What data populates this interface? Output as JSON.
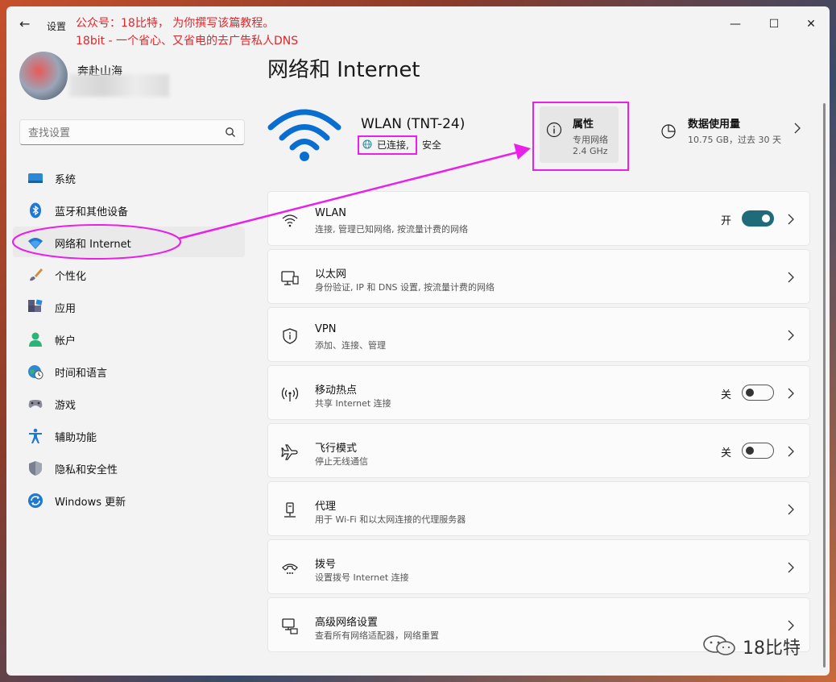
{
  "titlebar": {
    "back_glyph": "←",
    "title": "设置",
    "annotation_line1": "公众号：18比特， 为你撰写该篇教程。",
    "annotation_line2": "18bit - 一个省心、又省电的去广告私人DNS",
    "minimize_glyph": "—",
    "maximize_glyph": "☐",
    "close_glyph": "✕"
  },
  "user": {
    "name": "奔赴山海"
  },
  "search": {
    "placeholder": "查找设置"
  },
  "sidebar": {
    "items": [
      {
        "label": "系统",
        "icon": "display-icon",
        "active": false
      },
      {
        "label": "蓝牙和其他设备",
        "icon": "bluetooth-icon",
        "active": false
      },
      {
        "label": "网络和 Internet",
        "icon": "wifi-icon",
        "active": true
      },
      {
        "label": "个性化",
        "icon": "brush-icon",
        "active": false
      },
      {
        "label": "应用",
        "icon": "apps-icon",
        "active": false
      },
      {
        "label": "帐户",
        "icon": "person-icon",
        "active": false
      },
      {
        "label": "时间和语言",
        "icon": "globe-clock-icon",
        "active": false
      },
      {
        "label": "游戏",
        "icon": "gamepad-icon",
        "active": false
      },
      {
        "label": "辅助功能",
        "icon": "accessibility-icon",
        "active": false
      },
      {
        "label": "隐私和安全性",
        "icon": "shield-icon",
        "active": false
      },
      {
        "label": "Windows 更新",
        "icon": "update-icon",
        "active": false
      }
    ]
  },
  "main": {
    "title": "网络和 Internet",
    "network": {
      "ssid": "WLAN (TNT-24)",
      "status_connected": "已连接,",
      "status_secure": "安全"
    },
    "properties": {
      "title": "属性",
      "sub1": "专用网络",
      "sub2": "2.4 GHz"
    },
    "usage": {
      "title": "数据使用量",
      "sub": "10.75 GB，过去 30 天"
    },
    "rows": [
      {
        "title": "WLAN",
        "sub": "连接, 管理已知网络, 按流量计费的网络",
        "icon": "wifi-icon",
        "toggle": "on",
        "toggle_label": "开"
      },
      {
        "title": "以太网",
        "sub": "身份验证, IP 和 DNS 设置, 按流量计费的网络",
        "icon": "ethernet-icon",
        "toggle": null,
        "toggle_label": ""
      },
      {
        "title": "VPN",
        "sub": "添加、连接、管理",
        "icon": "vpn-shield-icon",
        "toggle": null,
        "toggle_label": ""
      },
      {
        "title": "移动热点",
        "sub": "共享 Internet 连接",
        "icon": "hotspot-icon",
        "toggle": "off",
        "toggle_label": "关"
      },
      {
        "title": "飞行模式",
        "sub": "停止无线通信",
        "icon": "airplane-icon",
        "toggle": "off",
        "toggle_label": "关"
      },
      {
        "title": "代理",
        "sub": "用于 Wi-Fi 和以太网连接的代理服务器",
        "icon": "proxy-icon",
        "toggle": null,
        "toggle_label": ""
      },
      {
        "title": "拨号",
        "sub": "设置拨号 Internet 连接",
        "icon": "dialup-icon",
        "toggle": null,
        "toggle_label": ""
      },
      {
        "title": "高级网络设置",
        "sub": "查看所有网络适配器，网络重置",
        "icon": "advanced-network-icon",
        "toggle": null,
        "toggle_label": ""
      }
    ]
  },
  "watermark": {
    "text": "18比特"
  },
  "colors": {
    "accent": "#1f6b7a",
    "annotation": "#e0262b",
    "highlight": "#e820e8",
    "wifi_blue": "#0a6ed1"
  }
}
